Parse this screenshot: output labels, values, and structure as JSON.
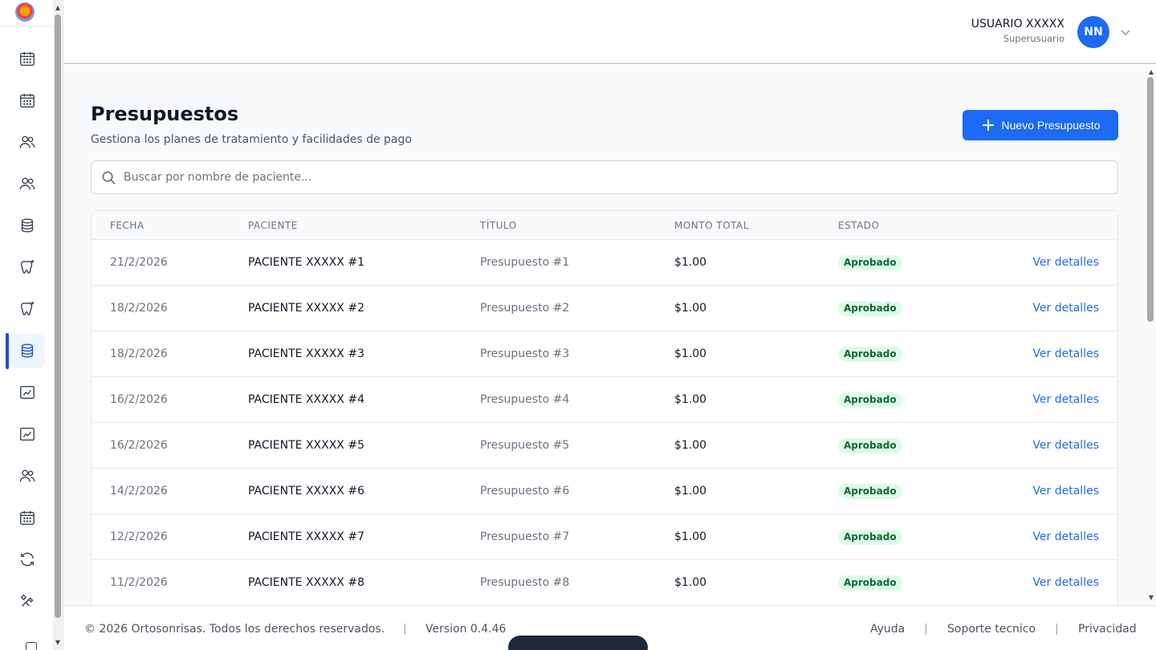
{
  "sidebar": {
    "icons": [
      "calendar-icon",
      "calendar-icon",
      "users-icon",
      "users-icon",
      "coins-icon",
      "tooth-sparkle-icon",
      "tooth-sparkle-icon",
      "coins-icon",
      "chart-icon",
      "chart-icon",
      "users-icon",
      "calendar-icon",
      "refresh-icon",
      "tools-icon"
    ],
    "active_index": 7
  },
  "header": {
    "user_name": "USUARIO XXXXX",
    "user_role": "Superusuario",
    "avatar_initials": "NN"
  },
  "page": {
    "title": "Presupuestos",
    "subtitle": "Gestiona los planes de tratamiento y facilidades de pago",
    "new_button_label": "Nuevo Presupuesto"
  },
  "search": {
    "placeholder": "Buscar por nombre de paciente...",
    "value": ""
  },
  "table": {
    "columns": [
      "FECHA",
      "PACIENTE",
      "TÍTULO",
      "MONTO TOTAL",
      "ESTADO"
    ],
    "action_label": "Ver detalles",
    "rows": [
      {
        "date": "21/2/2026",
        "patient": "PACIENTE XXXXX #1",
        "title": "Presupuesto #1",
        "amount": "$1.00",
        "status": "Aprobado"
      },
      {
        "date": "18/2/2026",
        "patient": "PACIENTE XXXXX #2",
        "title": "Presupuesto #2",
        "amount": "$1.00",
        "status": "Aprobado"
      },
      {
        "date": "18/2/2026",
        "patient": "PACIENTE XXXXX #3",
        "title": "Presupuesto #3",
        "amount": "$1.00",
        "status": "Aprobado"
      },
      {
        "date": "16/2/2026",
        "patient": "PACIENTE XXXXX #4",
        "title": "Presupuesto #4",
        "amount": "$1.00",
        "status": "Aprobado"
      },
      {
        "date": "16/2/2026",
        "patient": "PACIENTE XXXXX #5",
        "title": "Presupuesto #5",
        "amount": "$1.00",
        "status": "Aprobado"
      },
      {
        "date": "14/2/2026",
        "patient": "PACIENTE XXXXX #6",
        "title": "Presupuesto #6",
        "amount": "$1.00",
        "status": "Aprobado"
      },
      {
        "date": "12/2/2026",
        "patient": "PACIENTE XXXXX #7",
        "title": "Presupuesto #7",
        "amount": "$1.00",
        "status": "Aprobado"
      },
      {
        "date": "11/2/2026",
        "patient": "PACIENTE XXXXX #8",
        "title": "Presupuesto #8",
        "amount": "$1.00",
        "status": "Aprobado"
      }
    ]
  },
  "footer": {
    "copyright": "© 2026 Ortosonrisas. Todos los derechos reservados.",
    "separator": "|",
    "version": "Version 0.4.46",
    "links": [
      "Ayuda",
      "Soporte tecnico",
      "Privacidad"
    ]
  },
  "colors": {
    "accent": "#1d6af5",
    "status_approved_bg": "#dcfce7",
    "status_approved_text": "#166534"
  }
}
